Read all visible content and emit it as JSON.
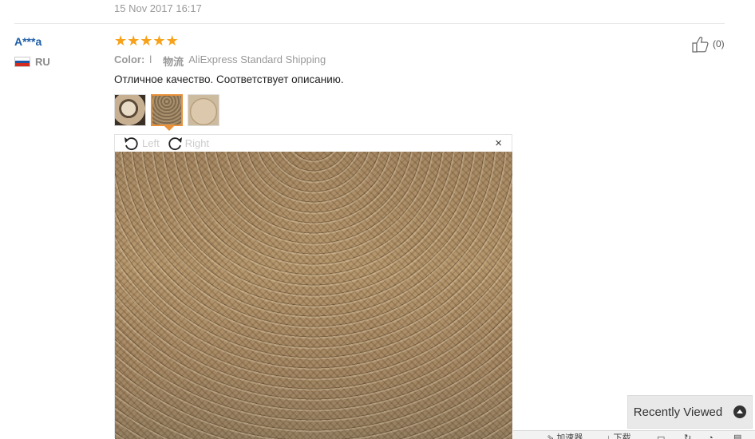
{
  "previous_review": {
    "date": "15 Nov 2017 16:17"
  },
  "review": {
    "user": {
      "name": "A***a",
      "country_code": "RU"
    },
    "rating": {
      "stars": 5,
      "max": 5
    },
    "meta": {
      "color_label": "Color:",
      "color_value": "l",
      "shipping_label": "物流",
      "shipping_value": "AliExpress Standard Shipping"
    },
    "text": "Отличное качество. Соответствует описанию.",
    "helpful": {
      "count_text": "(0)"
    },
    "thumbnails": [
      {
        "name": "photo-1"
      },
      {
        "name": "photo-2",
        "active": true
      },
      {
        "name": "photo-3"
      }
    ],
    "viewer": {
      "rotate_left_label": "Left",
      "rotate_right_label": "Right",
      "close_label": "×"
    }
  },
  "recently_viewed": {
    "label": "Recently Viewed"
  },
  "status_bar": {
    "accelerator": "加速器",
    "download": "下载"
  },
  "colors": {
    "star": "#f7a21a",
    "user_link": "#1e5ea8",
    "active_thumb_border": "#e8913a"
  }
}
